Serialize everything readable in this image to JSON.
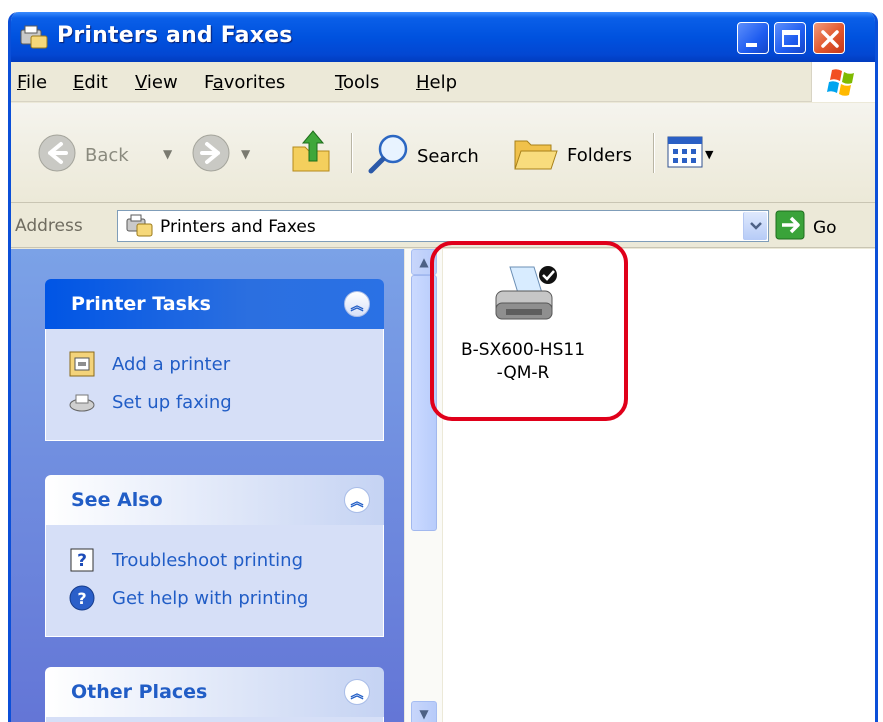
{
  "window": {
    "title": "Printers and Faxes"
  },
  "menu": [
    {
      "pre": "",
      "acc": "F",
      "post": "ile"
    },
    {
      "pre": "",
      "acc": "E",
      "post": "dit"
    },
    {
      "pre": "",
      "acc": "V",
      "post": "iew"
    },
    {
      "pre": "F",
      "acc": "a",
      "post": "vorites"
    },
    {
      "pre": "",
      "acc": "T",
      "post": "ools"
    },
    {
      "pre": "",
      "acc": "H",
      "post": "elp"
    }
  ],
  "toolbar": {
    "back_label": "Back",
    "search_label": "Search",
    "folders_label": "Folders"
  },
  "address": {
    "label": "Address",
    "value": "Printers and Faxes",
    "go_label": "Go"
  },
  "taskpane": {
    "printer_tasks": {
      "title": "Printer Tasks",
      "links": [
        "Add a printer",
        "Set up faxing"
      ]
    },
    "see_also": {
      "title": "See Also",
      "links": [
        "Troubleshoot printing",
        "Get help with printing"
      ]
    },
    "other_places": {
      "title": "Other Places"
    }
  },
  "content": {
    "printer_name_line1": "B-SX600-HS11",
    "printer_name_line2": "-QM-R"
  }
}
